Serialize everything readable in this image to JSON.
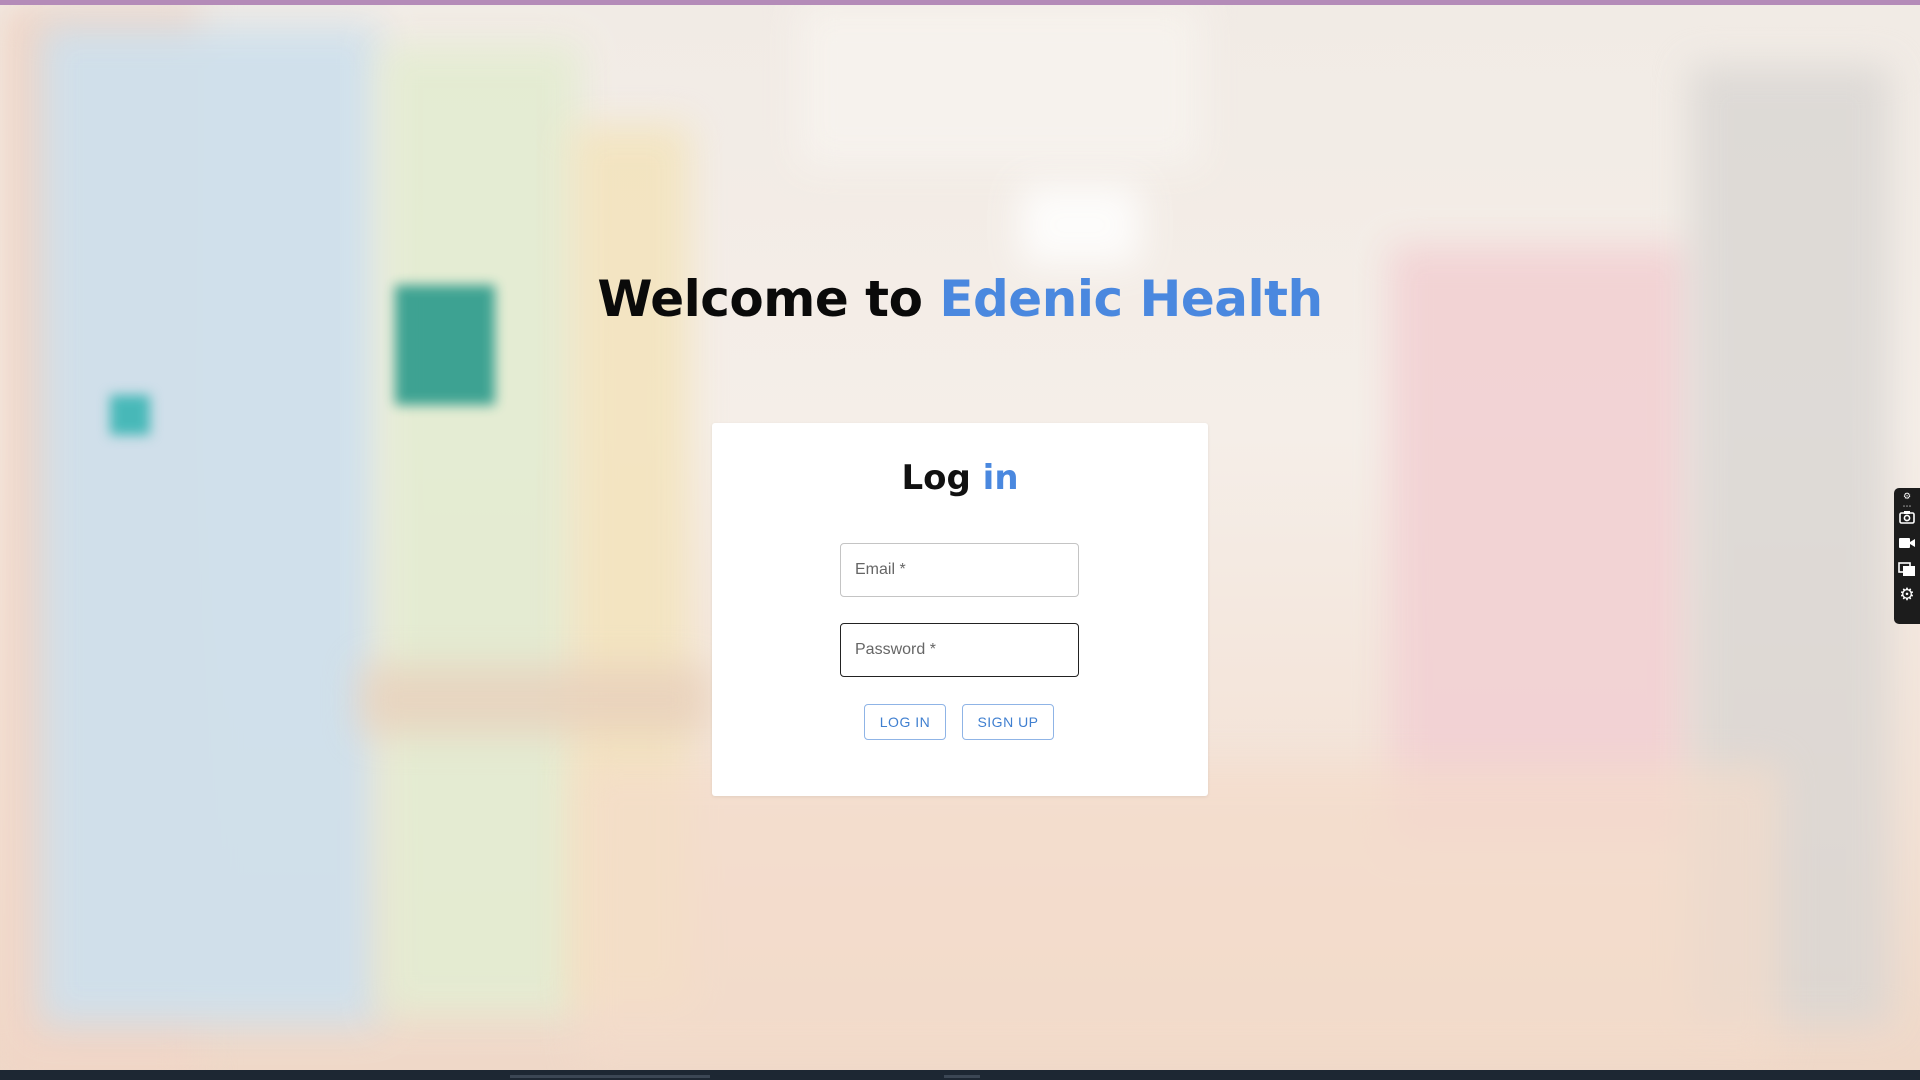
{
  "app": {
    "welcome_prefix": "Welcome to",
    "brand_name": "Edenic Health"
  },
  "login_card": {
    "title_prefix": "Log",
    "title_accent": "in",
    "email_placeholder": "Email *",
    "password_placeholder": "Password *",
    "login_button": "LOG IN",
    "signup_button": "SIGN UP"
  },
  "toolbar": {
    "icons": [
      "gear-small-icon",
      "camera-icon",
      "video-icon",
      "chat-icon",
      "settings-icon"
    ]
  },
  "colors": {
    "accent": "#4a88df",
    "button_text": "#3f7fd0",
    "heading": "#0a0a0a"
  }
}
